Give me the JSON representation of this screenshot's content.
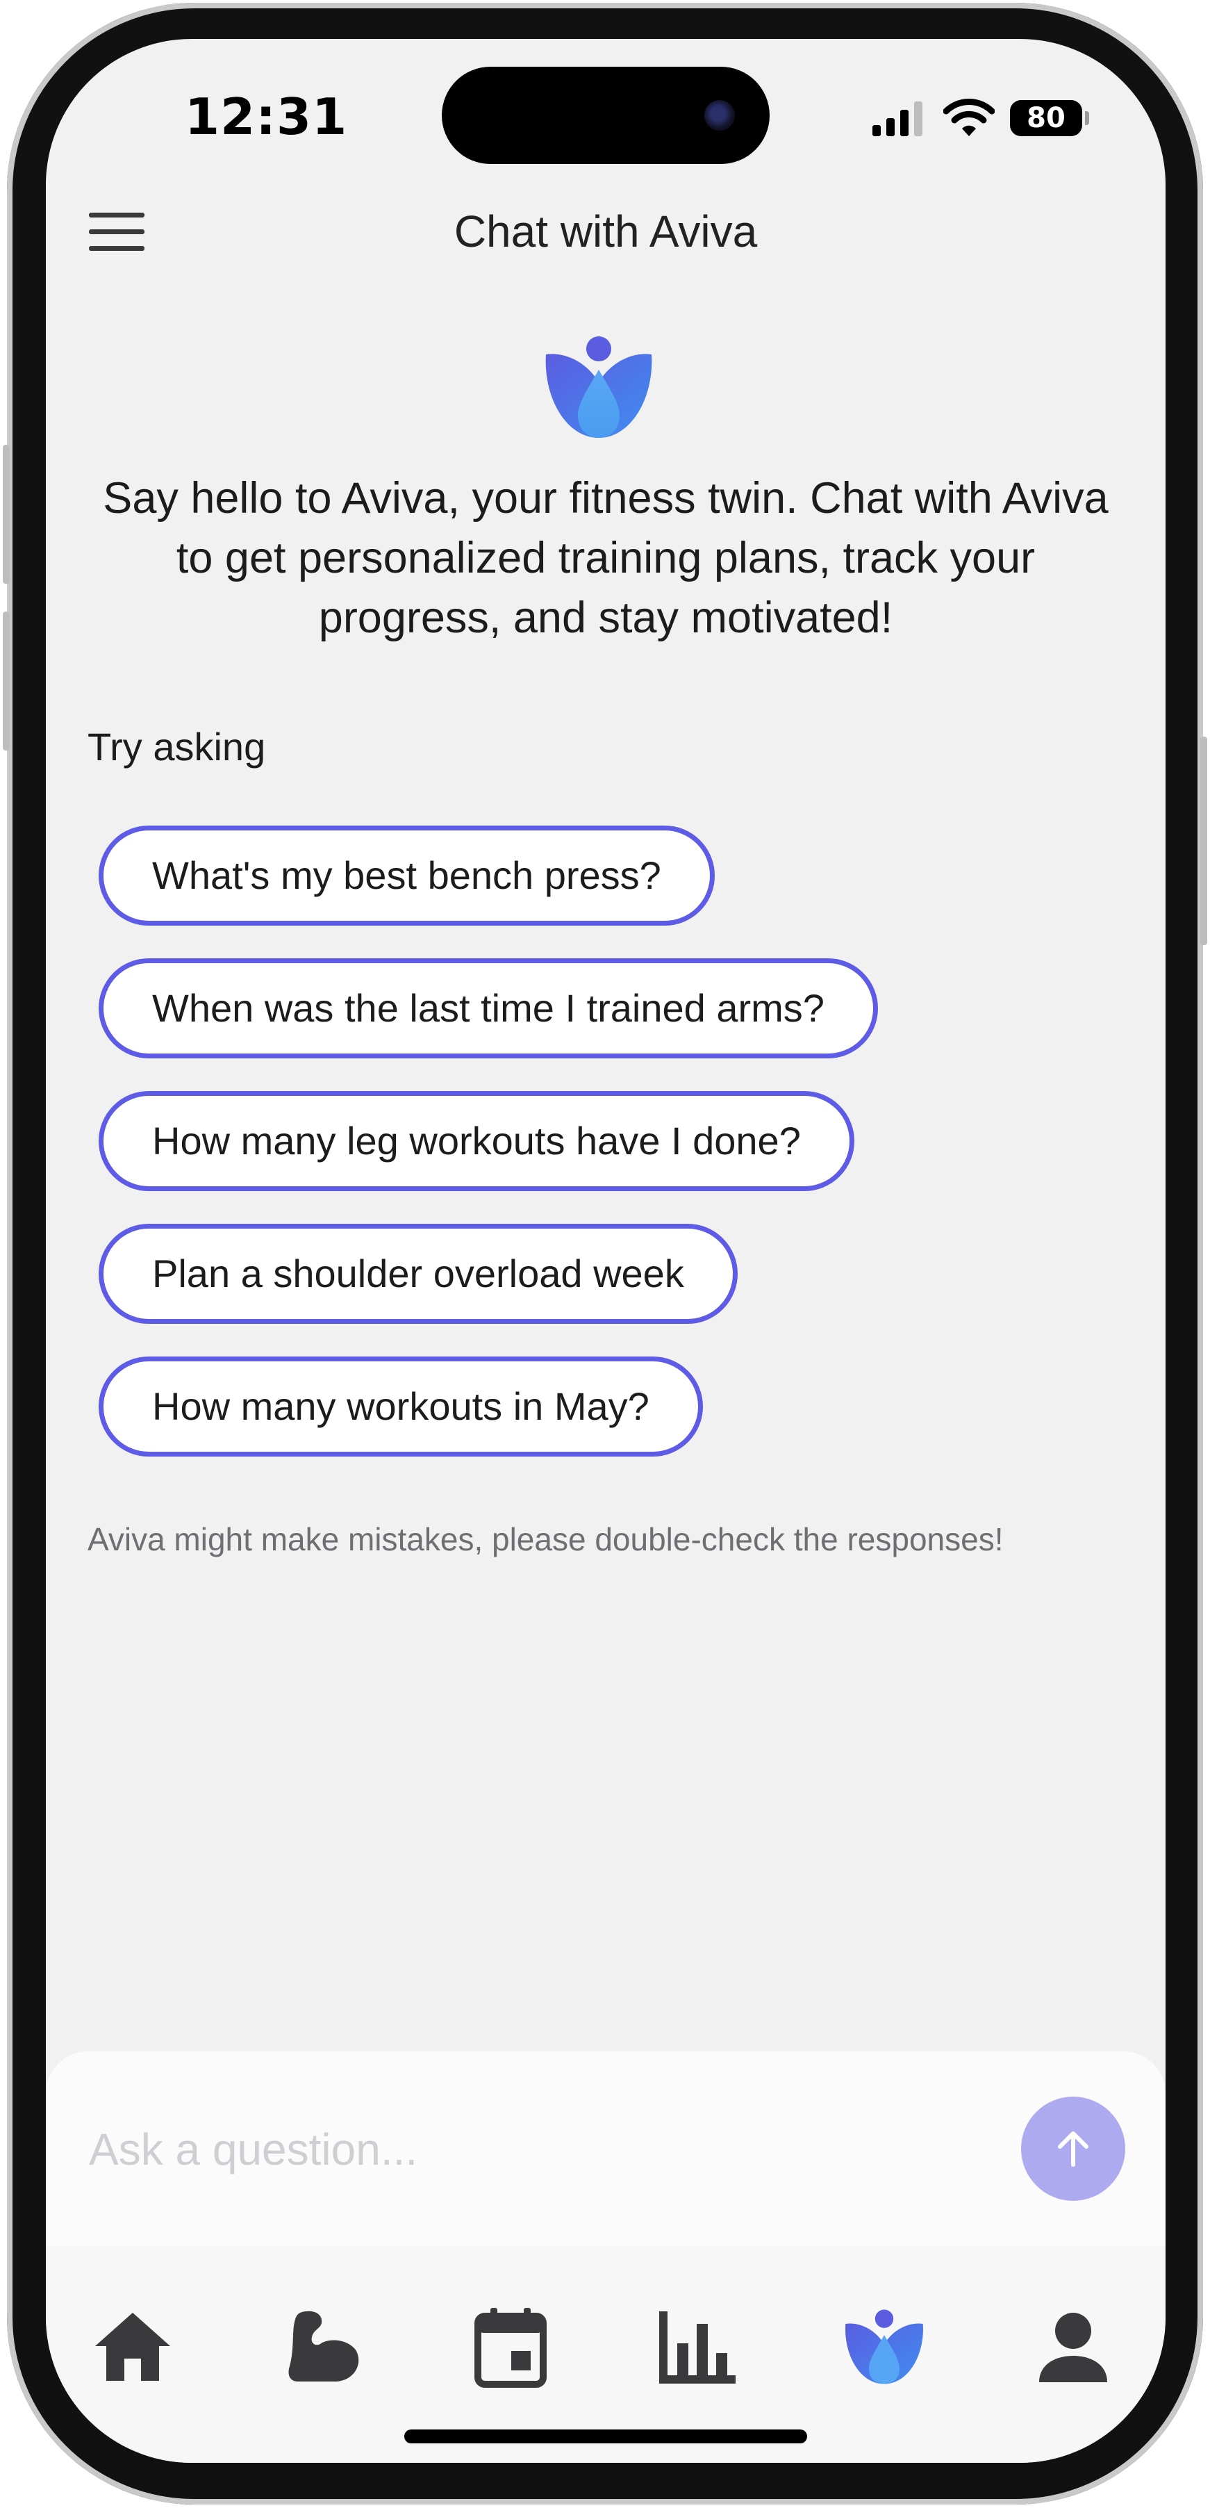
{
  "status_bar": {
    "time": "12:31",
    "battery": "80"
  },
  "header": {
    "title": "Chat with Aviva",
    "menu_icon": "hamburger-menu-icon"
  },
  "brand": {
    "logo_icon": "aviva-lotus-logo",
    "accent_color": "#5e5ce6",
    "logo_gradient": [
      "#5b5de0",
      "#4aa3f0"
    ]
  },
  "intro": {
    "text": "Say hello to Aviva, your fitness twin. Chat with Aviva to get personalized training plans, track your progress, and stay motivated!"
  },
  "suggestions": {
    "heading": "Try asking",
    "items": [
      "What's my best bench press?",
      "When was the last time I trained arms?",
      "How many leg workouts have I done?",
      "Plan a shoulder overload week",
      "How many workouts in May?"
    ]
  },
  "disclaimer": "Aviva might make mistakes, please double-check the responses!",
  "composer": {
    "placeholder": "Ask a question...",
    "value": "",
    "send_icon": "arrow-up-icon"
  },
  "tabbar": {
    "items": [
      {
        "icon": "home-icon",
        "active": false
      },
      {
        "icon": "bicep-icon",
        "active": false
      },
      {
        "icon": "calendar-icon",
        "active": false
      },
      {
        "icon": "bar-chart-icon",
        "active": false
      },
      {
        "icon": "aviva-icon",
        "active": true
      },
      {
        "icon": "person-icon",
        "active": false
      }
    ]
  }
}
